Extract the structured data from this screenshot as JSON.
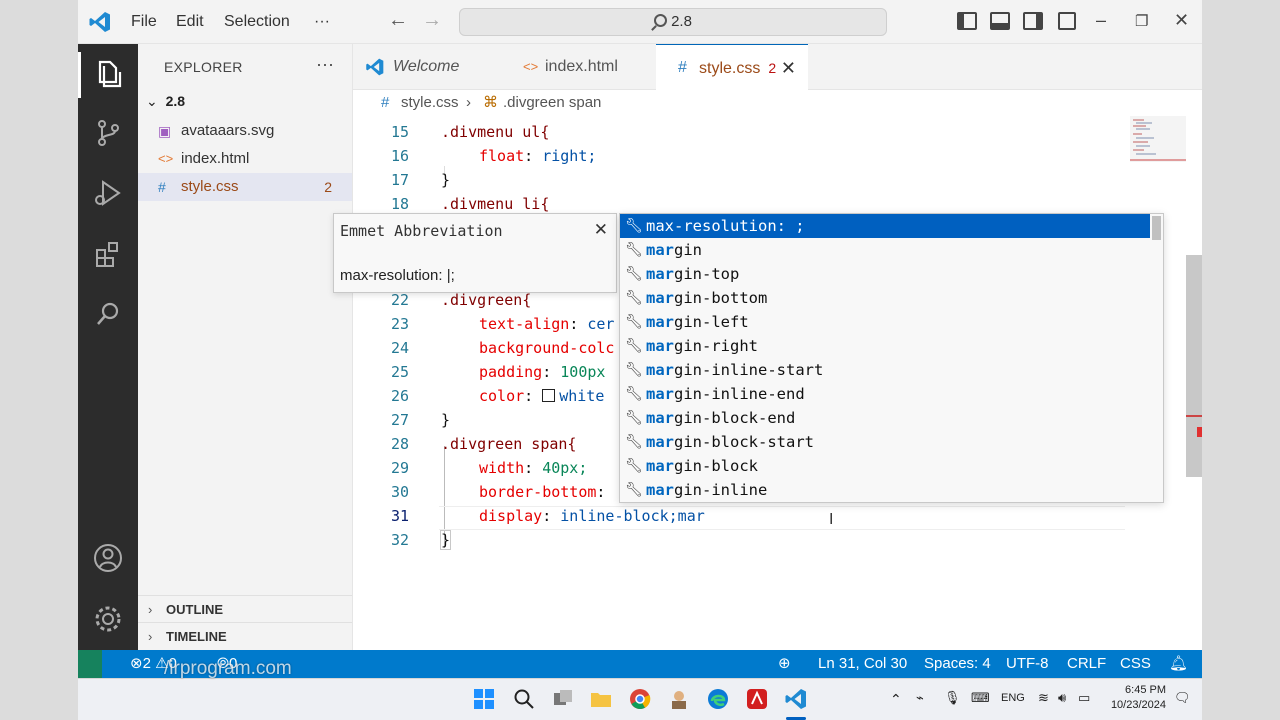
{
  "titlebar": {
    "menus": [
      "File",
      "Edit",
      "Selection",
      "···"
    ],
    "search_text": "2.8"
  },
  "sidebar": {
    "header": "EXPLORER",
    "folder": "2.8",
    "files": [
      {
        "name": "avataaars.svg",
        "icon": "svg-file-icon"
      },
      {
        "name": "index.html",
        "icon": "html-file-icon"
      },
      {
        "name": "style.css",
        "icon": "css-file-icon",
        "count": "2"
      }
    ],
    "sections": [
      "OUTLINE",
      "TIMELINE"
    ]
  },
  "tabs": [
    {
      "label": "Welcome"
    },
    {
      "label": "index.html"
    },
    {
      "label": "style.css",
      "problems": "2"
    }
  ],
  "breadcrumb": {
    "file": "style.css",
    "symbol": ".divgreen span"
  },
  "editor": {
    "lines": [
      {
        "n": "15",
        "text": ".divmenu ul{"
      },
      {
        "n": "16",
        "prop": "float",
        "val": "right;"
      },
      {
        "n": "17",
        "text": "}"
      },
      {
        "n": "18",
        "text": ".divmenu li{"
      },
      {
        "n": "22",
        "text": ".divgreen{"
      },
      {
        "n": "23",
        "prop": "text-align",
        "val": "cer"
      },
      {
        "n": "24",
        "prop": "background-colc"
      },
      {
        "n": "25",
        "prop": "padding",
        "num": "100px"
      },
      {
        "n": "26",
        "prop": "color",
        "val": "white"
      },
      {
        "n": "27",
        "text": "}"
      },
      {
        "n": "28",
        "text": ".divgreen span{"
      },
      {
        "n": "29",
        "prop": "width",
        "num": "40px;"
      },
      {
        "n": "30",
        "prop": "border-bottom"
      },
      {
        "n": "31",
        "prop": "display",
        "val": "inline-block;mar"
      },
      {
        "n": "32",
        "text": "}"
      }
    ]
  },
  "emmet": {
    "title": "Emmet Abbreviation",
    "body": "max-resolution: |;"
  },
  "suggestions": [
    {
      "match": "",
      "rest": "max-resolution: ;"
    },
    {
      "match": "mar",
      "rest": "gin"
    },
    {
      "match": "mar",
      "rest": "gin-top"
    },
    {
      "match": "mar",
      "rest": "gin-bottom"
    },
    {
      "match": "mar",
      "rest": "gin-left"
    },
    {
      "match": "mar",
      "rest": "gin-right"
    },
    {
      "match": "mar",
      "rest": "gin-inline-start"
    },
    {
      "match": "mar",
      "rest": "gin-inline-end"
    },
    {
      "match": "mar",
      "rest": "gin-block-end"
    },
    {
      "match": "mar",
      "rest": "gin-block-start"
    },
    {
      "match": "mar",
      "rest": "gin-block"
    },
    {
      "match": "mar",
      "rest": "gin-inline"
    }
  ],
  "status": {
    "errors": "2",
    "warnings": "0",
    "ports": "0",
    "position": "Ln 31, Col 30",
    "spaces": "Spaces: 4",
    "encoding": "UTF-8",
    "eol": "CRLF",
    "language": "CSS"
  },
  "taskbar": {
    "lang": "ENG",
    "time": "6:45 PM",
    "date": "10/23/2024"
  },
  "watermark": "/irprogram.com",
  "colors": {
    "accent": "#007acc",
    "selection": "#0060c0",
    "activity": "#2c2c2c"
  }
}
